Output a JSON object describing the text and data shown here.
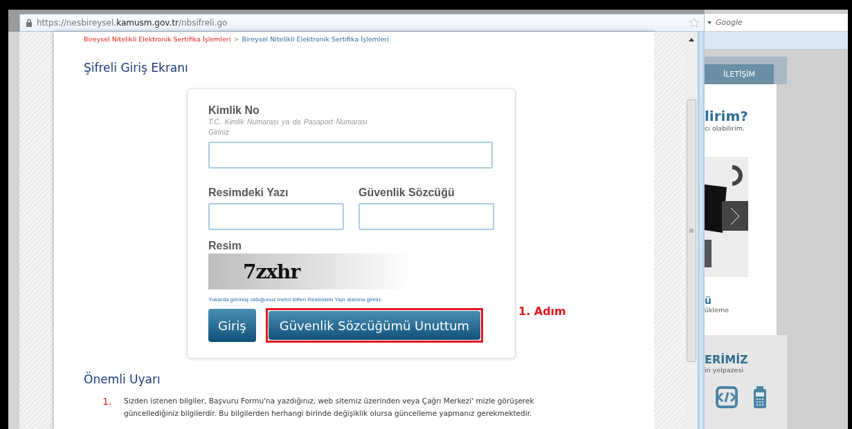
{
  "browser": {
    "url": "https://nesbireysel.**kamusm.gov.tr**/nbsifreli.go"
  },
  "breadcrumb": {
    "separator": ">",
    "items": [
      {
        "label": "Bireysel Nitelikli Elektronik Sertifika İşlemleri",
        "kind": "parent"
      },
      {
        "label": "Bireysel Nitelikli Elektronik Sertifika İşlemleri",
        "kind": "current"
      }
    ]
  },
  "page_title": "Şifreli Giriş Ekranı",
  "login_form": {
    "id_field": {
      "label": "Kimlik No",
      "hint": "T.C. Kimlik Numarası ya da Pasaport Numarası Giriniz"
    },
    "captcha_field": {
      "label": "Resimdeki Yazı"
    },
    "security_word_field": {
      "label": "Güvenlik Sözcüğü"
    },
    "captcha": {
      "label": "Resim",
      "text": "7zxhr",
      "note": "Yukarda görmüş olduğunuz metni lütfen Resimdeki Yazı alanına giriniz."
    },
    "buttons": [
      {
        "label": "Giriş",
        "highlighted": false
      },
      {
        "label": "Güvenlik Sözcüğümü Unuttum",
        "highlighted": true
      }
    ],
    "annotation": "1. Adım"
  },
  "warning": {
    "title": "Önemli Uyarı",
    "items": [
      {
        "number": "1.",
        "text": "Sizden istenen bilgiler, Başvuru Formu'na yazdığınız, web sitemiz üzerinden veya Çağrı Merkezi' mizle görüşerek güncellediğiniz bilgilerdir. Bu bilgilerden herhangi birinde değişiklik olursa güncelleme yapmanız gerekmektedir."
      }
    ]
  },
  "background_page": {
    "search": {
      "placeholder": "Google"
    },
    "nav_tab": "İLETİŞİM",
    "sections": [
      {
        "heading": "lirim?",
        "text": "cı olabilirim."
      },
      {
        "heading": "ü",
        "text": "ükleme"
      }
    ],
    "products": {
      "heading": "ERİMİZ",
      "text": "in yelpazesi"
    }
  }
}
